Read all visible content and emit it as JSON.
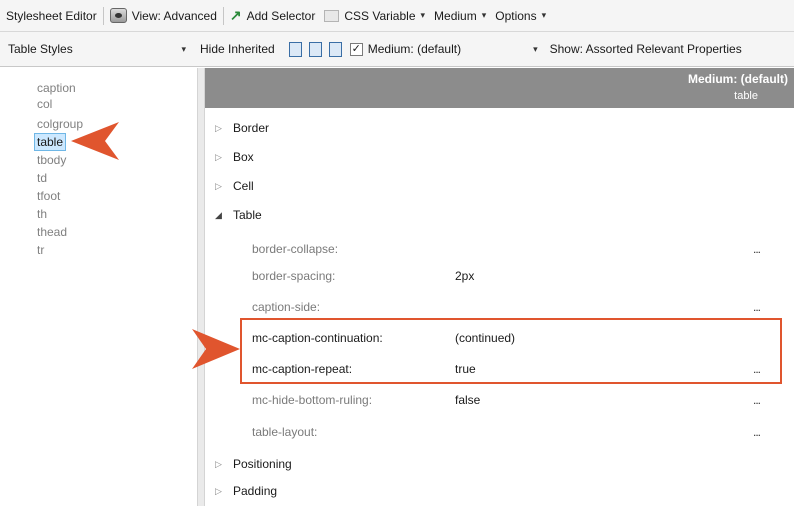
{
  "toolbar": {
    "title": "Stylesheet Editor",
    "view": "View: Advanced",
    "add_selector": "Add Selector",
    "css_variable": "CSS Variable",
    "medium": "Medium",
    "options": "Options"
  },
  "toolbar2": {
    "styles_combo": "Table Styles",
    "hide_inherited": "Hide Inherited",
    "medium_check": "Medium: (default)",
    "show_combo": "Show: Assorted Relevant Properties"
  },
  "selectors": [
    "caption",
    "col",
    "colgroup",
    "table",
    "tbody",
    "td",
    "tfoot",
    "th",
    "thead",
    "tr"
  ],
  "selected_selector": "table",
  "column_header": {
    "medium": "Medium: (default)",
    "selector": "table"
  },
  "groups": {
    "border": "Border",
    "box": "Box",
    "cell": "Cell",
    "table": "Table",
    "positioning": "Positioning",
    "padding": "Padding"
  },
  "properties": [
    {
      "name": "border-collapse:",
      "value": "",
      "more": "..."
    },
    {
      "name": "border-spacing:",
      "value": "2px",
      "more": ""
    },
    {
      "name": "caption-side:",
      "value": "",
      "more": "..."
    },
    {
      "name": "mc-caption-continuation:",
      "value": "(continued)",
      "more": ""
    },
    {
      "name": "mc-caption-repeat:",
      "value": "true",
      "more": "..."
    },
    {
      "name": "mc-hide-bottom-ruling:",
      "value": "false",
      "more": "..."
    },
    {
      "name": "table-layout:",
      "value": "",
      "more": "..."
    }
  ],
  "colors": {
    "highlight": "#e0552e",
    "selection": "#cce8ff",
    "header": "#8c8c8c"
  }
}
